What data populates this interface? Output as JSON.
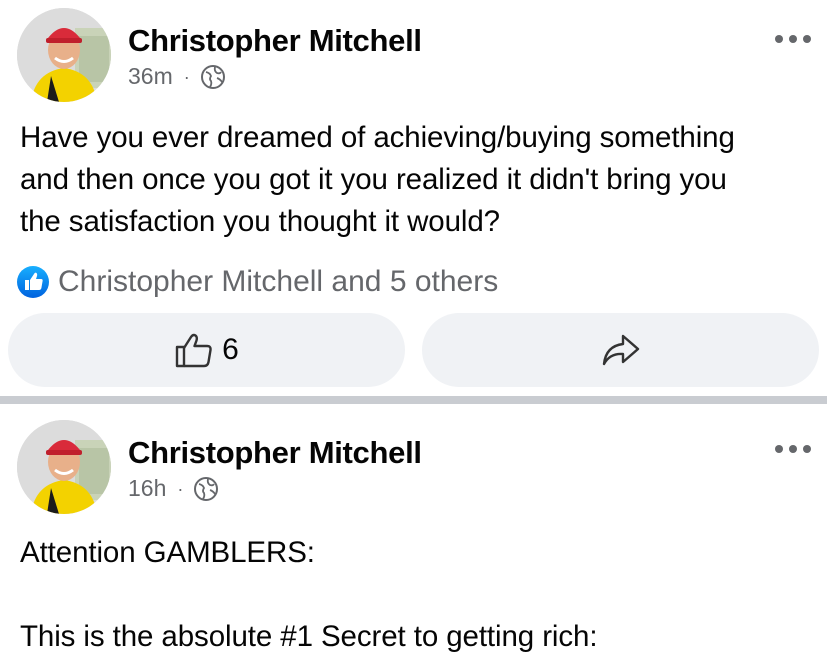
{
  "posts": [
    {
      "author": "Christopher Mitchell",
      "time": "36m",
      "separator": "·",
      "privacy_icon": "globe-icon",
      "text_lines": [
        "Have you ever dreamed of achieving/buying something",
        "and then once you got it you realized it didn't bring you",
        "the satisfaction you thought it would?"
      ],
      "reactions_text": "Christopher Mitchell and 5 others",
      "like_count": "6"
    },
    {
      "author": "Christopher Mitchell",
      "time": "16h",
      "separator": "·",
      "privacy_icon": "globe-icon",
      "text_lines": [
        "Attention GAMBLERS:",
        "",
        "This is the absolute #1 Secret to getting rich:"
      ]
    }
  ],
  "colors": {
    "accent": "#1877f2",
    "secondary_text": "#65676b",
    "button_bg": "#f0f2f5",
    "divider": "#c9ccd1"
  }
}
